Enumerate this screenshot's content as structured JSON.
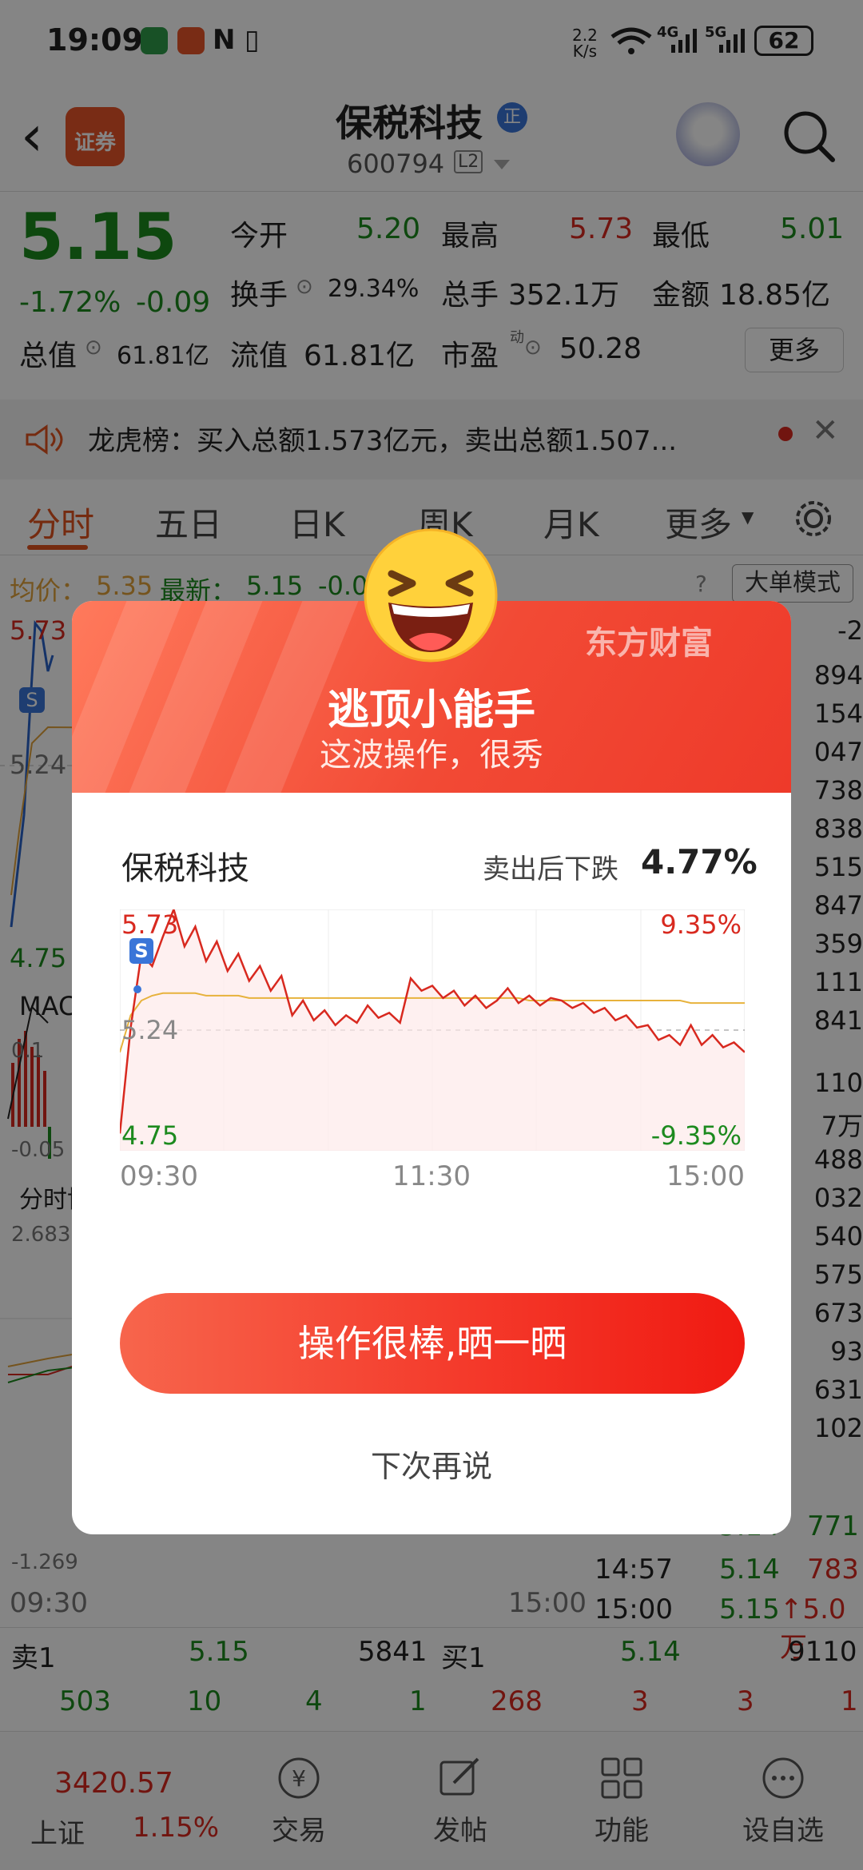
{
  "status_bar": {
    "time": "19:09",
    "speed_value": "2.2",
    "speed_unit": "K/s",
    "net1": "4G",
    "net2": "5G",
    "battery": "62"
  },
  "header": {
    "app_logo_text": "证券",
    "stock_name": "保税科技",
    "zheng_badge": "正",
    "stock_code": "600794",
    "level": "L2"
  },
  "quote": {
    "price": "5.15",
    "change_pct": "-1.72%",
    "change_abs": "-0.09",
    "rows": [
      [
        {
          "label": "今开",
          "value": "5.20",
          "color": "green"
        },
        {
          "label": "最高",
          "value": "5.73",
          "color": "red"
        },
        {
          "label": "最低",
          "value": "5.01",
          "color": "green"
        }
      ],
      [
        {
          "label": "换手",
          "value": "29.34%"
        },
        {
          "label": "总手",
          "value": "352.1万"
        },
        {
          "label": "金额",
          "value": "18.85亿"
        }
      ],
      [
        {
          "label": "总值",
          "value": "61.81亿"
        },
        {
          "label": "流值",
          "value": "61.81亿"
        },
        {
          "label": "市盈",
          "value": "50.28",
          "sup": "动"
        }
      ]
    ],
    "more_button": "更多"
  },
  "notice": {
    "text": "龙虎榜：买入总额1.573亿元，卖出总额1.507..."
  },
  "tabs": [
    "分时",
    "五日",
    "日K",
    "周K",
    "月K",
    "更多"
  ],
  "avg_row": {
    "avg_label": "均价：",
    "avg_value": "5.35",
    "latest_label": "最新：",
    "latest_value": "5.15",
    "change_partial": "-0.0",
    "big_order_mode": "大单模式"
  },
  "bg_chart": {
    "high": "5.73",
    "mid": "5.24",
    "low": "4.75",
    "macd": "MAC",
    "macd_high": "0.1",
    "macd_low": "-0.05",
    "game_label": "分时博",
    "game_high": "2.683",
    "game_low": "-1.269",
    "t_start": "09:30",
    "t_end": "15:00",
    "right_col": [
      "-2",
      "894",
      "154",
      "047",
      "738",
      "838",
      "515",
      "847",
      "359",
      "111",
      "841",
      "110",
      "7万",
      "488",
      "032",
      "540",
      "575",
      "673",
      "93",
      "631",
      "102"
    ],
    "ticks": [
      {
        "time": "14:57",
        "price": "5.14",
        "vol": "783"
      },
      {
        "time": "15:00",
        "price": "5.15",
        "vol": "↑5.0万"
      }
    ],
    "tick_partial": {
      "price": "5.14",
      "vol": "771"
    }
  },
  "order_book": {
    "sell1_label": "卖1",
    "sell1_price": "5.15",
    "sell1_vol": "5841",
    "buy1_label": "买1",
    "buy1_price": "5.14",
    "buy1_vol": "9110",
    "sell_counts": [
      "503",
      "10",
      "4",
      "1"
    ],
    "buy_counts": [
      "268",
      "3",
      "3",
      "1"
    ]
  },
  "bottom_nav": {
    "index_value": "3420.57",
    "index_name": "上证",
    "index_change": "1.15%",
    "items": [
      "交易",
      "发帖",
      "功能",
      "设自选"
    ]
  },
  "modal": {
    "brand": "东方财富",
    "title": "逃顶小能手",
    "subtitle": "这波操作，很秀",
    "stock_name": "保税科技",
    "fall_label": "卖出后下跌",
    "fall_value": "4.77%",
    "share_button": "操作很棒,晒一晒",
    "later_link": "下次再说",
    "chart_data": {
      "type": "line",
      "x": [
        "09:30",
        "11:30",
        "15:00"
      ],
      "y_high": "5.73",
      "y_mid": "5.24",
      "y_low": "4.75",
      "pct_high": "9.35%",
      "pct_low": "-9.35%",
      "ylim": [
        4.75,
        5.73
      ],
      "series": [
        {
          "values": [
            4.82,
            5.25,
            5.55,
            5.5,
            5.62,
            5.73,
            5.58,
            5.66,
            5.52,
            5.6,
            5.48,
            5.55,
            5.44,
            5.5,
            5.4,
            5.46,
            5.3,
            5.36,
            5.28,
            5.32,
            5.26,
            5.3,
            5.27,
            5.34,
            5.29,
            5.31,
            5.27,
            5.45,
            5.4,
            5.42,
            5.37,
            5.4,
            5.34,
            5.38,
            5.33,
            5.36,
            5.41,
            5.35,
            5.38,
            5.34,
            5.37,
            5.36,
            5.33,
            5.35,
            5.31,
            5.33,
            5.28,
            5.3,
            5.25,
            5.26,
            5.2,
            5.22,
            5.18,
            5.26,
            5.18,
            5.22,
            5.17,
            5.19,
            5.15
          ]
        },
        {
          "values": [
            5.15,
            5.3,
            5.36,
            5.38,
            5.39,
            5.39,
            5.39,
            5.39,
            5.38,
            5.38,
            5.38,
            5.38,
            5.37,
            5.37,
            5.37,
            5.37,
            5.37,
            5.37,
            5.37,
            5.37,
            5.37,
            5.37,
            5.37,
            5.37,
            5.37,
            5.37,
            5.37,
            5.37,
            5.37,
            5.37,
            5.37,
            5.37,
            5.37,
            5.37,
            5.37,
            5.37,
            5.37,
            5.37,
            5.36,
            5.36,
            5.36,
            5.36,
            5.36,
            5.36,
            5.36,
            5.36,
            5.36,
            5.36,
            5.36,
            5.36,
            5.36,
            5.36,
            5.36,
            5.35,
            5.35,
            5.35,
            5.35,
            5.35,
            5.35
          ]
        }
      ],
      "sell_marker": "S"
    }
  }
}
